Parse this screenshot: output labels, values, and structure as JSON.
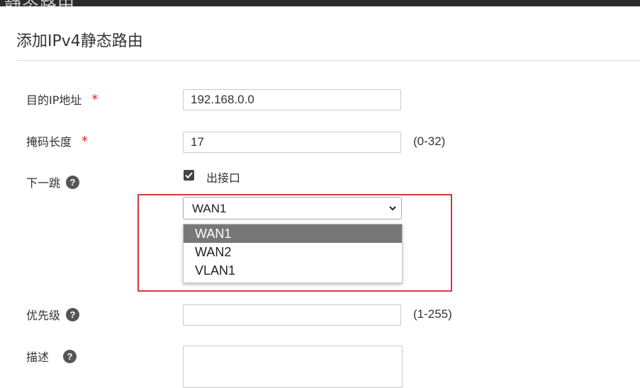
{
  "window": {
    "title_fragment": "静态路由"
  },
  "dialog": {
    "title": "添加IPv4静态路由"
  },
  "form": {
    "dest_ip": {
      "label": "目的IP地址",
      "value": "192.168.0.0",
      "required_mark": "*"
    },
    "mask_length": {
      "label": "掩码长度",
      "value": "17",
      "range": "(0-32)",
      "required_mark": "*"
    },
    "next_hop": {
      "label": "下一跳",
      "help": "?",
      "checkbox_label": "出接口",
      "checked": true,
      "select": {
        "value": "WAN1",
        "options": [
          "WAN1",
          "WAN2",
          "VLAN1"
        ],
        "highlighted": "WAN1"
      }
    },
    "priority": {
      "label": "优先级",
      "help": "?",
      "value": "",
      "range": "(1-255)"
    },
    "description": {
      "label": "描述",
      "help": "?",
      "value": ""
    }
  },
  "colors": {
    "required": "#e02020",
    "highlight_border": "#d9363e",
    "option_selected_bg": "#777777"
  }
}
